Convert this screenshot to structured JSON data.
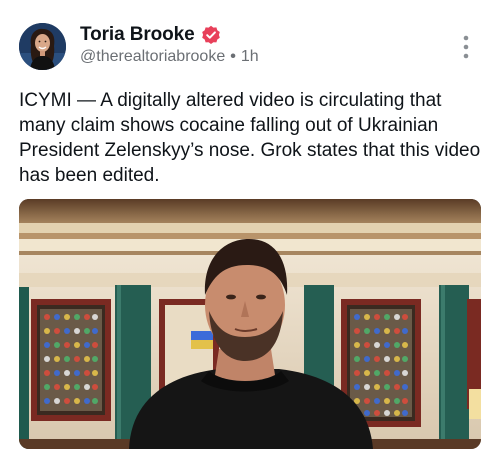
{
  "post": {
    "author": {
      "display_name": "Toria Brooke",
      "handle": "@therealtoriabrooke",
      "verified_badge": "verified-badge-icon",
      "avatar_icon": "profile-photo"
    },
    "separator": "•",
    "timestamp": "1h",
    "more_menu_icon": "vertical-ellipsis-icon",
    "text": "ICYMI — A digitally altered video is circulating that many claim shows cocaine falling out of Ukrainian President Zelenskyy’s nose. Grok states that this video has been edited.",
    "media": {
      "type": "video-thumbnail",
      "description_icon": "video-frame"
    }
  },
  "colors": {
    "badge": "#e8405a",
    "text": "#0f1419",
    "secondary_text": "#6b6f74",
    "more_icon": "#8a8f94"
  }
}
